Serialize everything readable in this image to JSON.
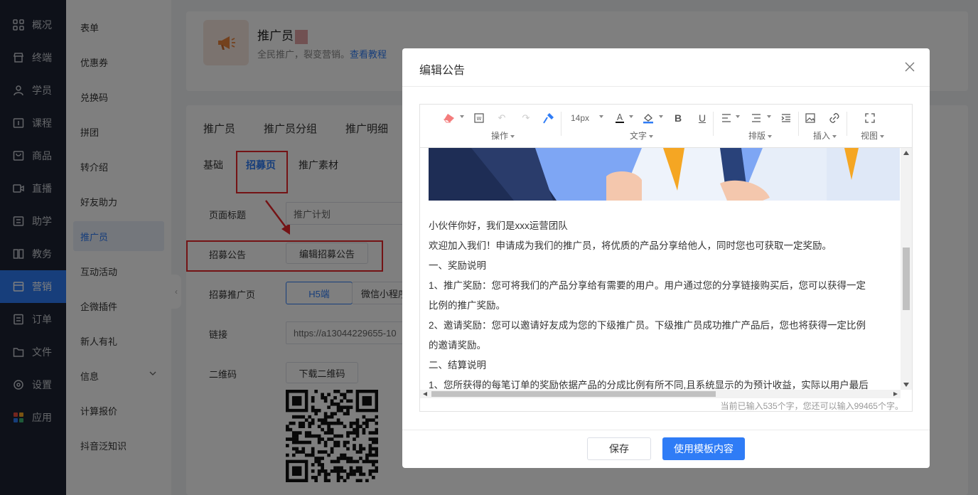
{
  "sidebar": {
    "items": [
      {
        "label": "概况",
        "icon": "grid-icon"
      },
      {
        "label": "终端",
        "icon": "store-icon"
      },
      {
        "label": "学员",
        "icon": "user-icon"
      },
      {
        "label": "课程",
        "icon": "course-icon"
      },
      {
        "label": "商品",
        "icon": "bag-icon"
      },
      {
        "label": "直播",
        "icon": "video-icon"
      },
      {
        "label": "助学",
        "icon": "study-icon"
      },
      {
        "label": "教务",
        "icon": "book-icon"
      },
      {
        "label": "营销",
        "icon": "marketing-icon",
        "active": true
      },
      {
        "label": "订单",
        "icon": "order-icon"
      },
      {
        "label": "文件",
        "icon": "folder-icon"
      },
      {
        "label": "设置",
        "icon": "gear-icon"
      },
      {
        "label": "应用",
        "icon": "apps-icon"
      }
    ]
  },
  "subnav": {
    "items": [
      {
        "label": "表单"
      },
      {
        "label": "优惠券"
      },
      {
        "label": "兑换码"
      },
      {
        "label": "拼团"
      },
      {
        "label": "转介绍"
      },
      {
        "label": "好友助力"
      },
      {
        "label": "推广员",
        "active": true
      },
      {
        "label": "互动活动"
      },
      {
        "label": "企微插件"
      },
      {
        "label": "新人有礼"
      },
      {
        "label": "信息"
      },
      {
        "label": "计算报价"
      },
      {
        "label": "抖音泛知识"
      }
    ]
  },
  "page": {
    "title": "推广员",
    "subtitle": "全民推广，裂变营销。",
    "tutorial_link": "查看教程",
    "tabs": [
      "推广员",
      "推广员分组",
      "推广明细"
    ],
    "subtabs": [
      "基础",
      "招募页",
      "推广素材"
    ],
    "form": {
      "page_title_label": "页面标题",
      "page_title_value": "推广计划",
      "notice_label": "招募公告",
      "notice_button": "编辑招募公告",
      "recruit_label": "招募推广页",
      "recruit_h5": "H5端",
      "recruit_mini": "微信小程序",
      "link_label": "链接",
      "link_value": "https://a13044229655-10",
      "qr_label": "二维码",
      "qr_button": "下载二维码"
    }
  },
  "modal": {
    "title": "编辑公告",
    "toolbar": {
      "groups": [
        "操作",
        "文字",
        "排版",
        "插入",
        "视图"
      ],
      "font_size": "14px"
    },
    "content": {
      "paragraphs": [
        "小伙伴你好，我们是xxx运营团队",
        "欢迎加入我们！申请成为我们的推广员，将优质的产品分享给他人，同时您也可获取一定奖励。",
        "一、奖励说明",
        "1、推广奖励：您可将我们的产品分享给有需要的用户。用户通过您的分享链接购买后，您可以获得一定",
        "比例的推广奖励。",
        "2、邀请奖励：您可以邀请好友成为您的下级推广员。下级推广员成功推广产品后，您也将获得一定比例",
        "的邀请奖励。",
        "二、结算说明",
        "1、您所获得的每笔订单的奖励依据产品的分成比例有所不同,且系统显示的为预计收益，实际以用户最后"
      ]
    },
    "word_count": "当前已输入535个字，您还可以输入99465个字。",
    "save_button": "保存",
    "template_button": "使用模板内容"
  },
  "colors": {
    "accent": "#2f7cf6",
    "annotation_red": "#e8262b",
    "sidebar_bg": "#1c2233"
  }
}
